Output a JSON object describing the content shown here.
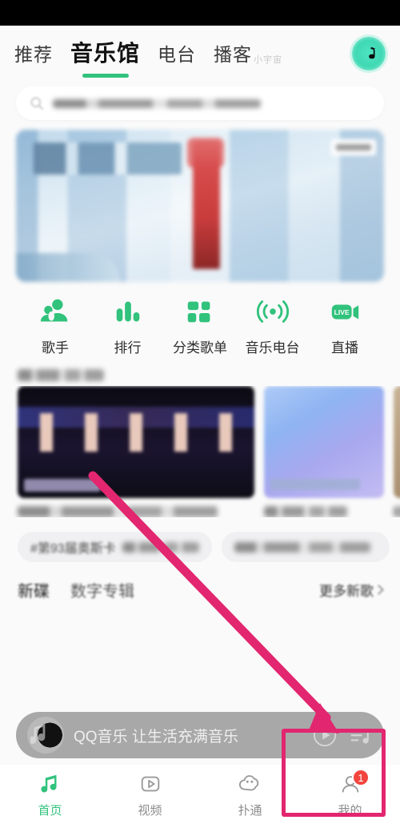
{
  "app": {
    "name": "QQ音乐"
  },
  "topbar": {
    "tabs": [
      {
        "label": "推荐",
        "active": false
      },
      {
        "label": "音乐馆",
        "active": true
      },
      {
        "label": "电台",
        "active": false
      },
      {
        "label": "播客",
        "active": false
      }
    ],
    "podcast_sup": "小宇宙",
    "avatar_icon": "music-note-icon"
  },
  "search": {
    "placeholder": "",
    "icon": "search-icon",
    "value": ""
  },
  "banner": {
    "label": ""
  },
  "entries": [
    {
      "label": "歌手",
      "icon": "singer-icon"
    },
    {
      "label": "排行",
      "icon": "ranking-bars-icon"
    },
    {
      "label": "分类歌单",
      "icon": "category-grid-icon"
    },
    {
      "label": "音乐电台",
      "icon": "radio-wave-icon"
    },
    {
      "label": "直播",
      "icon": "live-camera-icon"
    }
  ],
  "section": {
    "title": ""
  },
  "cards": [
    {
      "title": "",
      "caption": ""
    },
    {
      "title": "",
      "caption": ""
    },
    {
      "title": "",
      "caption": ""
    }
  ],
  "tags": [
    {
      "label": "#第93届奥斯卡"
    },
    {
      "label": ""
    }
  ],
  "newsong": {
    "items": [
      {
        "label": "新碟"
      },
      {
        "label": "数字专辑"
      }
    ],
    "more_label": "更多新歌",
    "more_icon": "chevron-right-icon"
  },
  "miniplayer": {
    "title": "QQ音乐 让生活充满音乐",
    "play_icon": "play-circle-icon",
    "playlist_icon": "playlist-icon",
    "cover_icon": "music-note-icon"
  },
  "bottomnav": [
    {
      "label": "首页",
      "icon": "home-music-icon",
      "active": true,
      "badge": ""
    },
    {
      "label": "视频",
      "icon": "video-play-icon",
      "active": false,
      "badge": ""
    },
    {
      "label": "扑通",
      "icon": "community-cloud-icon",
      "active": false,
      "badge": ""
    },
    {
      "label": "我的",
      "icon": "profile-icon",
      "active": false,
      "badge": "1"
    }
  ],
  "annotation": {
    "arrow_color": "#e2266f",
    "highlight_color": "#e2266f",
    "target_label": "我的"
  },
  "colors": {
    "accent": "#31c27c",
    "badge": "#f2453d",
    "annotation": "#e2266f"
  }
}
